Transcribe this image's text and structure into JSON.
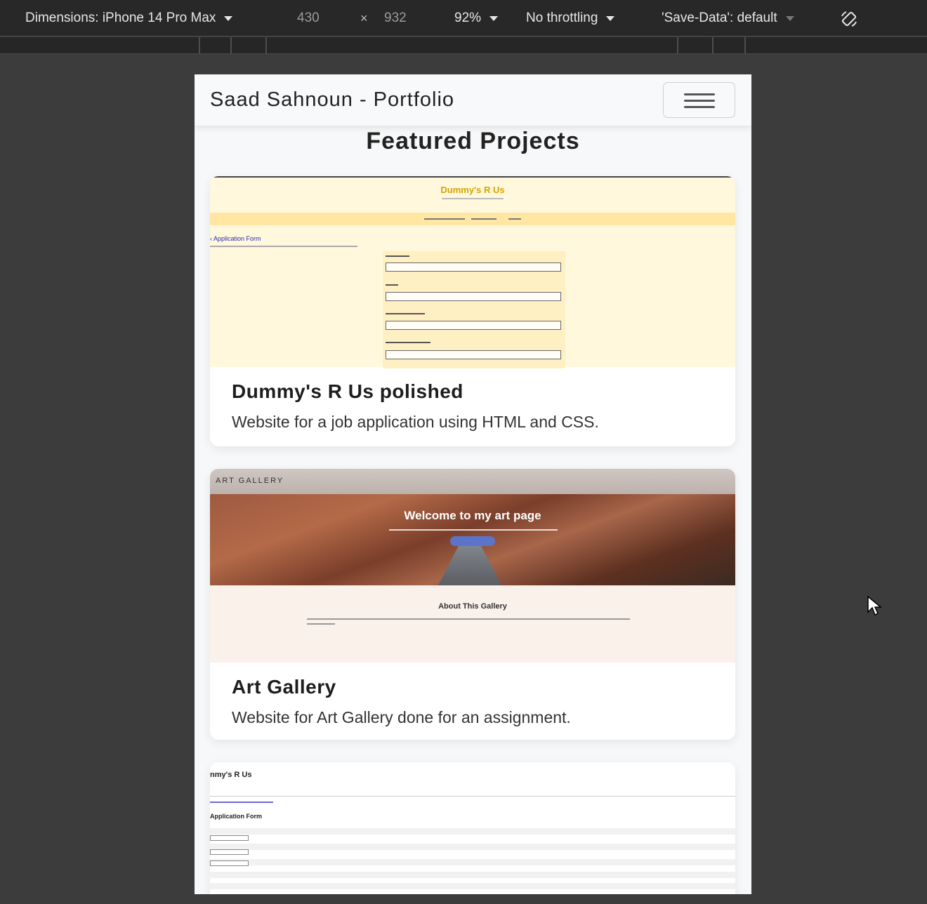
{
  "devtools": {
    "dimensions_label": "Dimensions: iPhone 14 Pro Max",
    "width_value": "430",
    "times_symbol": "×",
    "height_value": "932",
    "zoom": "92%",
    "throttling": "No throttling",
    "save_data": "'Save-Data': default"
  },
  "site": {
    "brand": "Saad Sahnoun - Portfolio",
    "section_title": "Featured Projects",
    "projects": [
      {
        "title": "Dummy's R Us polished",
        "description": "Website for a job application using HTML and CSS.",
        "preview": {
          "site_title": "Dummy's R Us",
          "link": "‹ Application Form"
        }
      },
      {
        "title": "Art Gallery",
        "description": "Website for Art Gallery done for an assignment.",
        "preview": {
          "logo": "ART GALLERY",
          "hero_title": "Welcome to my art page",
          "about_title": "About This Gallery"
        }
      },
      {
        "preview": {
          "site_title": "nmy's R Us",
          "form_title": "Application Form"
        }
      }
    ]
  }
}
